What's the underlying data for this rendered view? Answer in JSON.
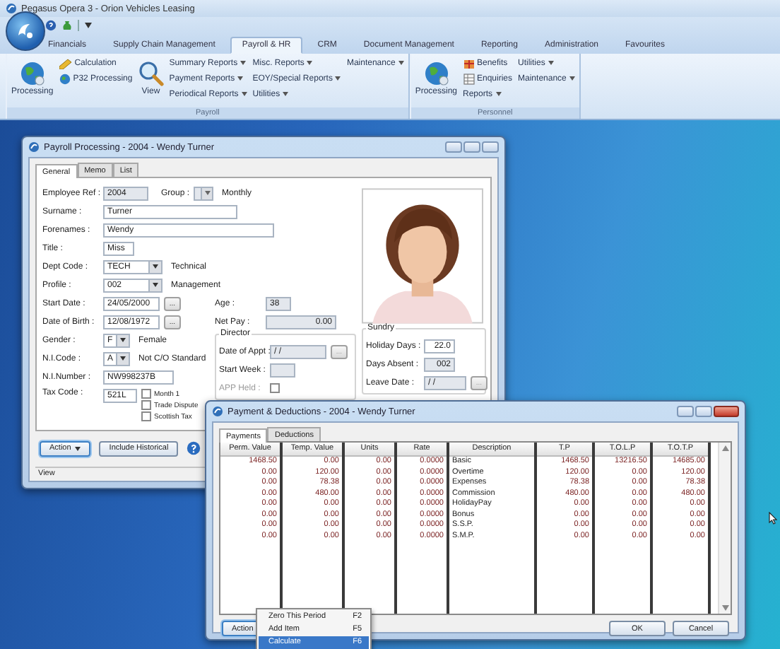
{
  "window": {
    "title": "Pegasus Opera 3 - Orion Vehicles Leasing"
  },
  "ribbon_tabs": [
    {
      "label": "Financials",
      "selected": false
    },
    {
      "label": "Supply Chain Management",
      "selected": false
    },
    {
      "label": "Payroll & HR",
      "selected": true
    },
    {
      "label": "CRM",
      "selected": false
    },
    {
      "label": "Document Management",
      "selected": false
    },
    {
      "label": "Reporting",
      "selected": false
    },
    {
      "label": "Administration",
      "selected": false
    },
    {
      "label": "Favourites",
      "selected": false
    }
  ],
  "ribbon_groups": [
    {
      "label": "Payroll",
      "columns": [
        [
          {
            "kind": "large",
            "label": "Processing"
          }
        ],
        [
          {
            "kind": "small",
            "label": "Calculation"
          },
          {
            "kind": "small",
            "label": "P32 Processing"
          }
        ],
        [
          {
            "kind": "large",
            "label": "View"
          }
        ],
        [
          {
            "kind": "menu",
            "label": "Summary Reports"
          },
          {
            "kind": "menu",
            "label": "Payment Reports"
          },
          {
            "kind": "menu",
            "label": "Periodical Reports"
          }
        ],
        [
          {
            "kind": "menu",
            "label": "Misc. Reports"
          },
          {
            "kind": "menu",
            "label": "EOY/Special Reports"
          },
          {
            "kind": "menu",
            "label": "Utilities"
          }
        ],
        [
          {
            "kind": "menu",
            "label": "Maintenance"
          }
        ]
      ]
    },
    {
      "label": "Personnel",
      "columns": [
        [
          {
            "kind": "large",
            "label": "Processing"
          }
        ],
        [
          {
            "kind": "small",
            "label": "Benefits"
          },
          {
            "kind": "small",
            "label": "Enquiries"
          },
          {
            "kind": "menu",
            "label": "Reports"
          }
        ],
        [
          {
            "kind": "menu",
            "label": "Utilities"
          },
          {
            "kind": "menu",
            "label": "Maintenance"
          }
        ]
      ]
    }
  ],
  "payroll_window": {
    "title": "Payroll Processing - 2004 - Wendy Turner",
    "tabs": [
      {
        "label": "General",
        "selected": true
      },
      {
        "label": "Memo",
        "selected": false
      },
      {
        "label": "List",
        "selected": false
      }
    ],
    "employee_ref": {
      "label": "Employee Ref :",
      "value": "2004",
      "readonly": true
    },
    "group": {
      "label": "Group :",
      "note": "Monthly",
      "readonly": true
    },
    "surname": {
      "label": "Surname :",
      "value": "Turner",
      "readonly": false
    },
    "forenames": {
      "label": "Forenames :",
      "value": "Wendy",
      "readonly": false
    },
    "title_field": {
      "label": "Title :",
      "value": "Miss",
      "readonly": false
    },
    "dept_code": {
      "label": "Dept Code :",
      "value": "TECH",
      "note": "Technical",
      "readonly": false
    },
    "profile": {
      "label": "Profile :",
      "value": "002",
      "note": "Management",
      "readonly": false
    },
    "start_date": {
      "label": "Start Date :",
      "value": "24/05/2000",
      "button": "...",
      "readonly": false
    },
    "date_of_birth": {
      "label": "Date of Birth :",
      "value": "12/08/1972",
      "button": "...",
      "readonly": false
    },
    "gender": {
      "label": "Gender :",
      "value": "F",
      "note": "Female",
      "readonly": false
    },
    "ni_code": {
      "label": "N.I.Code :",
      "value": "A",
      "note": "Not C/O Standard",
      "readonly": false
    },
    "ni_number": {
      "label": "N.I.Number :",
      "value": "NW998237B",
      "readonly": false
    },
    "tax_code": {
      "label": "Tax Code :",
      "value": "521L",
      "readonly": false
    },
    "tax_options": [
      {
        "label": "Month 1",
        "checked": false
      },
      {
        "label": "Trade Dispute",
        "checked": false
      },
      {
        "label": "Scottish Tax",
        "checked": false
      }
    ],
    "age": {
      "label": "Age :",
      "value": "38",
      "readonly": true
    },
    "net_pay": {
      "label": "Net Pay :",
      "value": "0.00",
      "readonly": true
    },
    "director": {
      "label": "Director",
      "date_of_appt": {
        "label": "Date of Appt :",
        "value": "/ /",
        "button": "...",
        "readonly": true
      },
      "start_week": {
        "label": "Start Week :",
        "readonly": true
      },
      "app_held": {
        "label": "APP Held :",
        "checked": false,
        "disabled": true
      }
    },
    "sundry": {
      "label": "Sundry",
      "holiday_days": {
        "label": "Holiday Days :",
        "value": "22.0",
        "readonly": false
      },
      "days_absent": {
        "label": "Days Absent :",
        "value": "002",
        "readonly": true
      },
      "leave_date": {
        "label": "Leave Date :",
        "value": "/ /",
        "button": "...",
        "readonly": true
      }
    },
    "action_button": "Action",
    "include_historical_button": "Include Historical",
    "status_bar": "View"
  },
  "payments_window": {
    "title": "Payment & Deductions - 2004 - Wendy Turner",
    "tabs": [
      {
        "label": "Payments",
        "selected": true
      },
      {
        "label": "Deductions",
        "selected": false
      }
    ],
    "columns": [
      "Perm. Value",
      "Temp. Value",
      "Units",
      "Rate",
      "Description",
      "T.P",
      "T.O.L.P",
      "T.O.T.P"
    ],
    "rows": [
      [
        "1468.50",
        "0.00",
        "0.00",
        "0.0000",
        "Basic",
        "1468.50",
        "13216.50",
        "14685.00"
      ],
      [
        "0.00",
        "120.00",
        "0.00",
        "0.0000",
        "Overtime",
        "120.00",
        "0.00",
        "120.00"
      ],
      [
        "0.00",
        "78.38",
        "0.00",
        "0.0000",
        "Expenses",
        "78.38",
        "0.00",
        "78.38"
      ],
      [
        "0.00",
        "480.00",
        "0.00",
        "0.0000",
        "Commission",
        "480.00",
        "0.00",
        "480.00"
      ],
      [
        "0.00",
        "0.00",
        "0.00",
        "0.0000",
        "HolidayPay",
        "0.00",
        "0.00",
        "0.00"
      ],
      [
        "0.00",
        "0.00",
        "0.00",
        "0.0000",
        "Bonus",
        "0.00",
        "0.00",
        "0.00"
      ],
      [
        "0.00",
        "0.00",
        "0.00",
        "0.0000",
        "S.S.P.",
        "0.00",
        "0.00",
        "0.00"
      ],
      [
        "0.00",
        "0.00",
        "0.00",
        "0.0000",
        "S.M.P.",
        "0.00",
        "0.00",
        "0.00"
      ]
    ],
    "action_button": "Action",
    "menu": [
      {
        "label": "Zero This Period",
        "shortcut": "F2",
        "selected": false
      },
      {
        "label": "Add Item",
        "shortcut": "F5",
        "selected": false
      },
      {
        "label": "Calculate",
        "shortcut": "F6",
        "selected": true
      }
    ],
    "buttons": [
      "OK",
      "Cancel"
    ]
  }
}
